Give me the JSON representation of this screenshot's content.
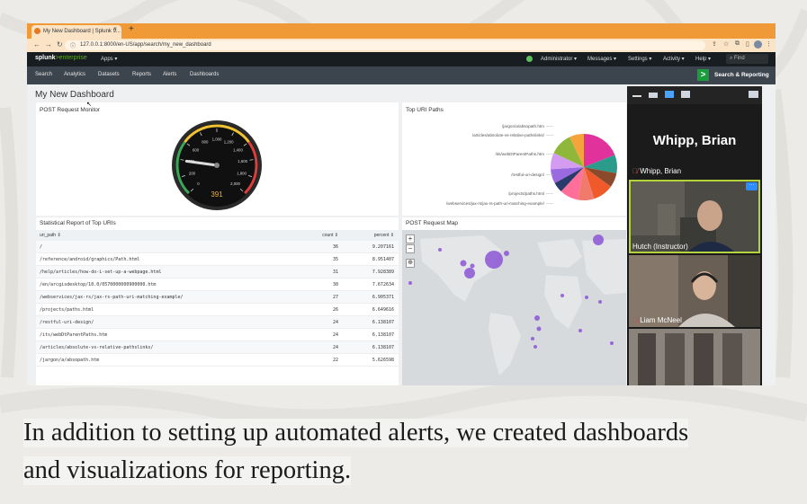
{
  "browser": {
    "tab_title": "My New Dashboard | Splunk 9...",
    "tab_close": "×",
    "new_tab": "+",
    "url": "127.0.0.1:8000/en-US/app/search/my_new_dashboard",
    "icons": [
      "back-icon",
      "forward-icon",
      "reload-icon",
      "share-icon",
      "star-icon",
      "extensions-icon",
      "sidebar-icon",
      "profile-icon",
      "menu-icon"
    ]
  },
  "splunk": {
    "logo_main": "splunk",
    "logo_suffix": ">enterprise",
    "apps_menu": "Apps ▾",
    "menus": {
      "admin": "Administrator ▾",
      "messages": "Messages ▾",
      "settings": "Settings ▾",
      "activity": "Activity ▾",
      "help": "Help ▾"
    },
    "find_placeholder": "Find",
    "nav": [
      "Search",
      "Analytics",
      "Datasets",
      "Reports",
      "Alerts",
      "Dashboards"
    ],
    "app_label": "Search & Reporting",
    "accent": "#65a637"
  },
  "dashboard": {
    "title": "My New Dashboard",
    "gauge": {
      "title": "POST Request Monitor",
      "value": 391,
      "value_label": "391",
      "max": 2000,
      "ticks": [
        "0",
        "200",
        "400",
        "600",
        "800",
        "1,000",
        "1,200",
        "1,400",
        "1,600",
        "1,800",
        "2,000"
      ],
      "bands": [
        "#3aa757",
        "#f1c232",
        "#d93f3c"
      ]
    },
    "pie": {
      "title": "Top URI Paths",
      "labels": [
        "/jargon/a/absopath.htm",
        "/articles/absolute-vs-relative-pathslinks/",
        "/its/webDtParentPaths.htm",
        "/restful-uri-design/",
        "/projects/paths.html",
        "/webservices/jax-rs/jax-rs-path-uri-matching-example/"
      ]
    },
    "table": {
      "title": "Statistical Report of Top URIs",
      "columns": [
        "uri_path ⇕",
        "count ⇕",
        "percent ⇕"
      ],
      "rows": [
        [
          "/",
          "36",
          "9.207161"
        ],
        [
          "/reference/android/graphics/Path.html",
          "35",
          "8.951407"
        ],
        [
          "/help/articles/how-do-i-set-up-a-webpage.html",
          "31",
          "7.928389"
        ],
        [
          "/en/arcgisdesktop/10.0/0570000000900000.htm",
          "30",
          "7.672634"
        ],
        [
          "/webservices/jax-rs/jax-rs-path-uri-matching-example/",
          "27",
          "6.905371"
        ],
        [
          "/projects/paths.html",
          "26",
          "6.649616"
        ],
        [
          "/restful-uri-design/",
          "24",
          "6.138107"
        ],
        [
          "/its/webDtParentPaths.htm",
          "24",
          "6.138107"
        ],
        [
          "/articles/absolute-vs-relative-pathslinks/",
          "24",
          "6.138107"
        ],
        [
          "/jargon/a/absopath.htm",
          "22",
          "5.626598"
        ]
      ]
    },
    "map": {
      "title": "POST Request Map",
      "zoom_in": "+",
      "zoom_out": "−"
    }
  },
  "zoom": {
    "host_big": "Whipp, Brian",
    "host_name": "Whipp, Brian",
    "p1": "Hutch (Instructor)",
    "p2": "Liam McNeel",
    "more": "···"
  },
  "caption": {
    "line1": "In addition to setting up automated alerts, we created dashboards",
    "line2": "and visualizations for reporting."
  }
}
